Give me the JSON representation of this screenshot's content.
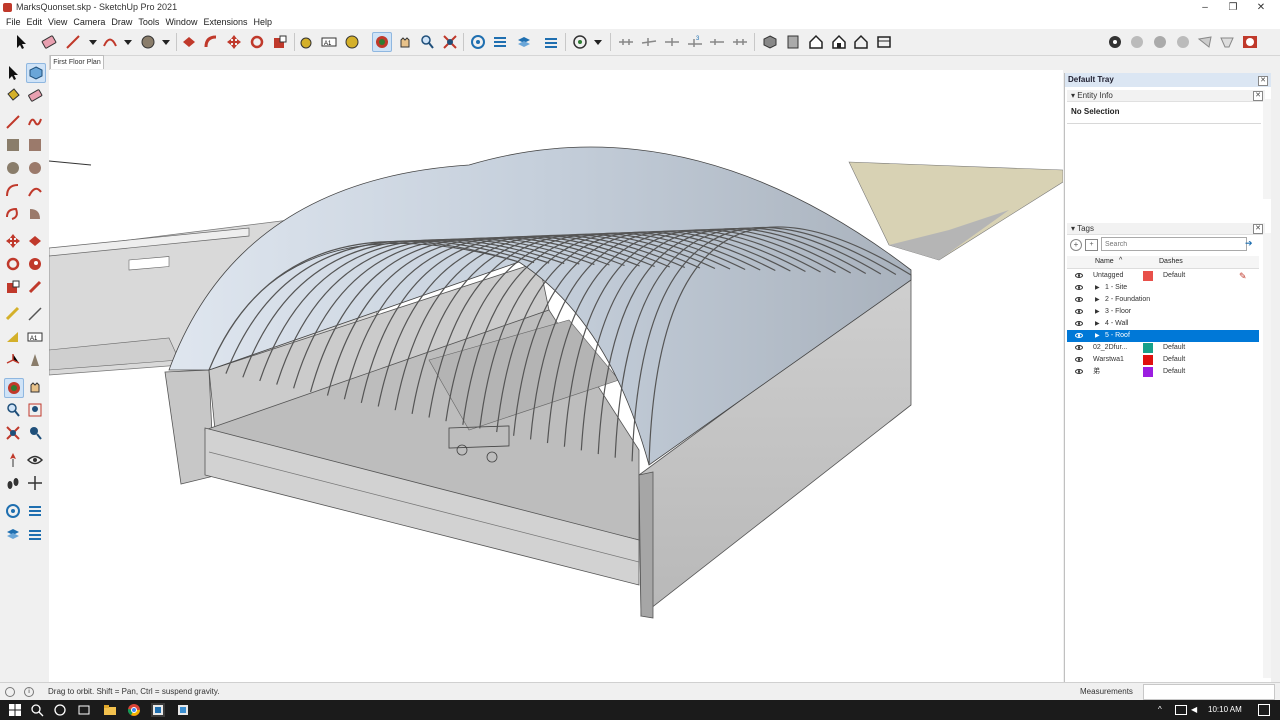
{
  "window": {
    "title": "MarksQuonset.skp - SketchUp Pro 2021"
  },
  "menu": [
    "File",
    "Edit",
    "View",
    "Camera",
    "Draw",
    "Tools",
    "Window",
    "Extensions",
    "Help"
  ],
  "scene_tab": "First Floor Plan",
  "tray": {
    "title": "Default Tray",
    "entity_info": {
      "header": "Entity Info",
      "selection": "No Selection"
    },
    "tags": {
      "header": "Tags",
      "search_placeholder": "Search",
      "col_name": "Name",
      "col_dashes": "Dashes",
      "rows": [
        {
          "name": "Untagged",
          "dashes": "Default",
          "color": "#e8504a",
          "group": false,
          "selected": false
        },
        {
          "name": "1 - Site",
          "dashes": "",
          "color": "",
          "group": true,
          "selected": false
        },
        {
          "name": "2 - Foundation",
          "dashes": "",
          "color": "",
          "group": true,
          "selected": false
        },
        {
          "name": "3 - Floor",
          "dashes": "",
          "color": "",
          "group": true,
          "selected": false
        },
        {
          "name": "4 - Wall",
          "dashes": "",
          "color": "",
          "group": true,
          "selected": false
        },
        {
          "name": "5 - Roof",
          "dashes": "",
          "color": "",
          "group": true,
          "selected": true
        },
        {
          "name": "02_2Dfur...",
          "dashes": "Default",
          "color": "#17a08a",
          "group": false,
          "selected": false
        },
        {
          "name": "Warstwa1",
          "dashes": "Default",
          "color": "#e01010",
          "group": false,
          "selected": false
        },
        {
          "name": "弟",
          "dashes": "Default",
          "color": "#9b1ee0",
          "group": false,
          "selected": false
        }
      ]
    }
  },
  "status": {
    "hint": "Drag to orbit. Shift = Pan, Ctrl = suspend gravity.",
    "measurements_label": "Measurements"
  },
  "taskbar": {
    "time": "10:10 AM"
  }
}
